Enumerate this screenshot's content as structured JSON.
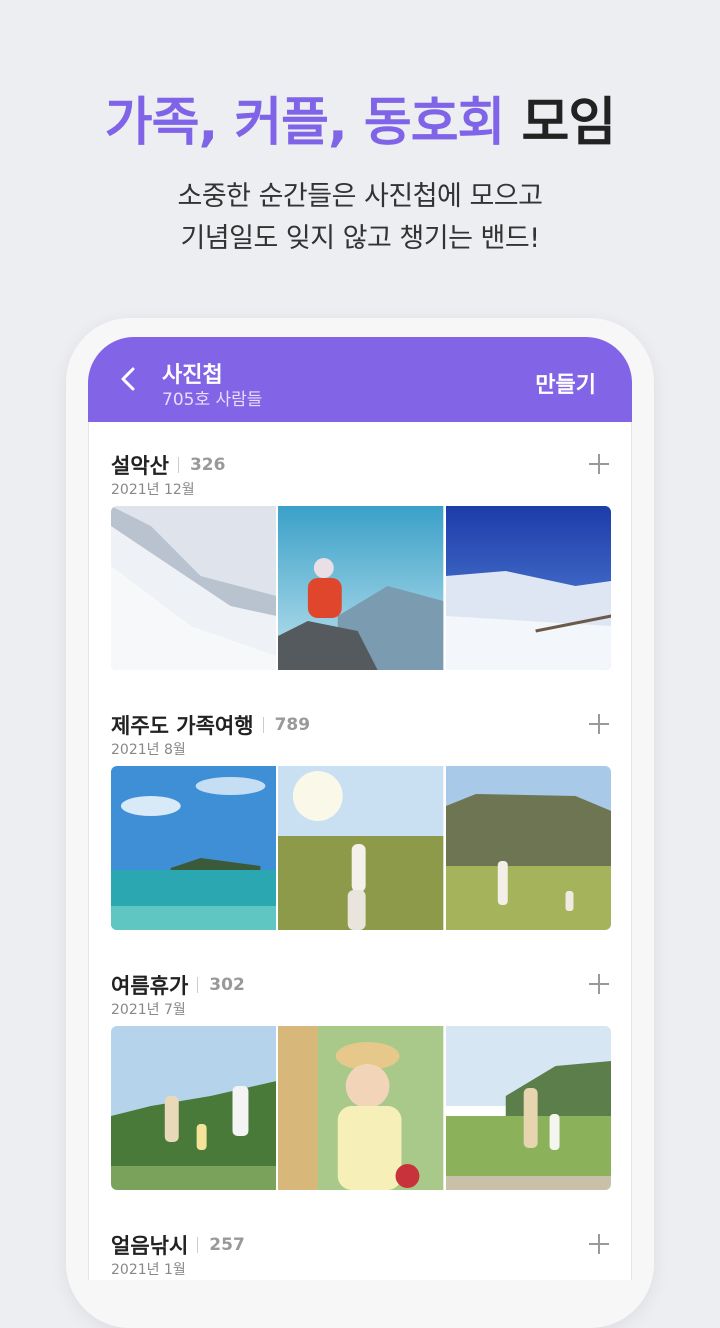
{
  "hero": {
    "title_accent": "가족, 커플, 동호회",
    "title_rest": "모임",
    "subtitle_line1": "소중한 순간들은 사진첩에 모으고",
    "subtitle_line2": "기념일도 잊지 않고 챙기는 밴드!"
  },
  "appbar": {
    "title": "사진첩",
    "subtitle": "705호 사람들",
    "action": "만들기",
    "back_icon": "chevron-left-icon"
  },
  "albums": [
    {
      "name": "설악산",
      "count": "326",
      "date": "2021년 12월"
    },
    {
      "name": "제주도 가족여행",
      "count": "789",
      "date": "2021년 8월"
    },
    {
      "name": "여름휴가",
      "count": "302",
      "date": "2021년 7월"
    },
    {
      "name": "얼음낚시",
      "count": "257",
      "date": "2021년 1월"
    }
  ],
  "colors": {
    "accent": "#8064e8",
    "appbar": "#8264e6",
    "background": "#edeef1"
  }
}
